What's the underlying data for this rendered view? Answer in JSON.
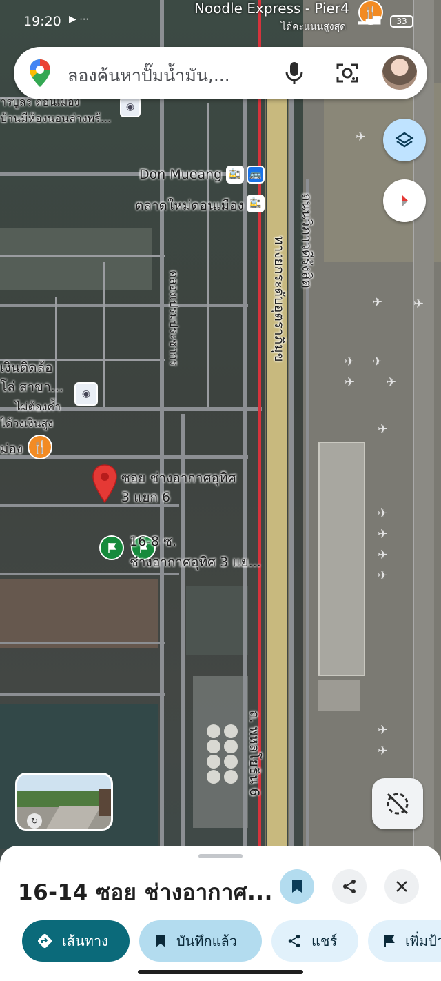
{
  "status_bar": {
    "time": "19:20",
    "battery": "33"
  },
  "map": {
    "labels": {
      "noodle_express": "Noodle Express - Pier4",
      "noodle_sub": "ได้คะแนนสูงสุด",
      "don_mueang": "Don Mueang",
      "market": "ตลาดใหม่ดอนเมือง",
      "khlong_prem": "คลองเปรมประชากร",
      "vibhavadi": "ถนนวิภาวดีรังสิต",
      "expressway": "ทางยกระดับอุตราภิมุข",
      "phahonyothin": "ถ. พหลโยธิน 6",
      "loan_1": "เงินติดล้อ",
      "loan_2": "โล่ สาขา...",
      "loan_3": "ไม่ต้องค้ำ",
      "loan_4": "ได้วงเงินสูง",
      "muang": "ม่อง",
      "top_left_1": "ารบูลร ดอนเมือง",
      "top_left_2": "บ้านมีห้องนอนล่างพร้...",
      "pin_label_1": "ซอย ช่างอากาศอุทิศ",
      "pin_label_2": "3 แยก 6",
      "flag_label_1": "16-8 ซ.",
      "flag_label_2": "ช่างอากาศอุทิศ 3 แย..."
    }
  },
  "search": {
    "placeholder": "ลองค้นหาปั๊มน้ำมัน,..."
  },
  "sheet": {
    "title": "16-14 ซอย ช่างอากาศ...",
    "chips": {
      "directions": "เส้นทาง",
      "saved": "บันทึกแล้ว",
      "share": "แชร์",
      "more": "เพิ่มป้าย"
    }
  },
  "colors": {
    "accent_teal": "#0b6a7a",
    "chip_blue": "#c2e7ff",
    "saved_blue": "#b3dcef",
    "pin_red": "#e53935",
    "flag_green": "#168a3c"
  }
}
